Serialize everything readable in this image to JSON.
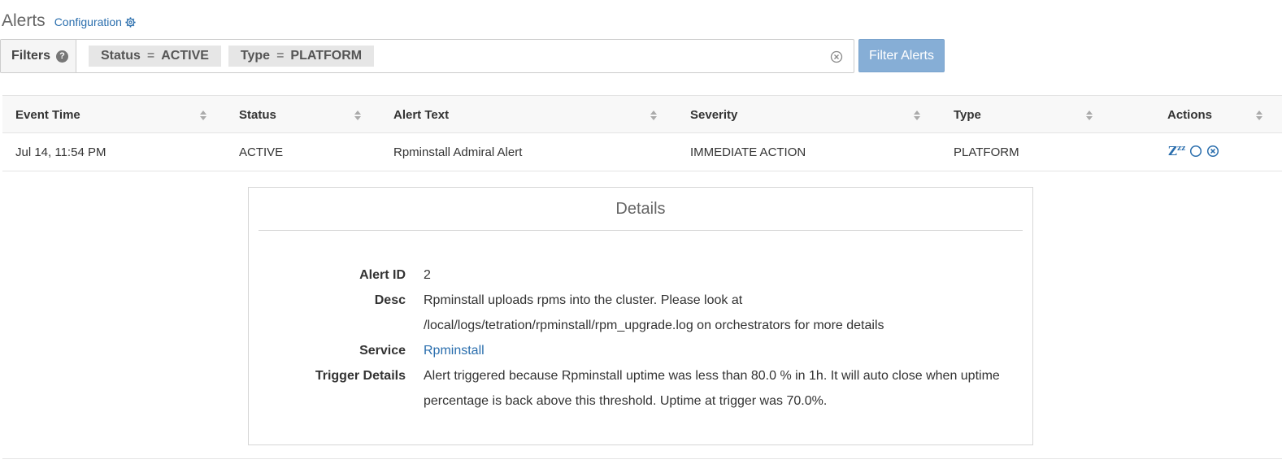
{
  "header": {
    "title": "Alerts",
    "config_label": "Configuration"
  },
  "filters": {
    "label": "Filters",
    "chips": [
      {
        "key": "Status",
        "op": "=",
        "value": "ACTIVE"
      },
      {
        "key": "Type",
        "op": "=",
        "value": "PLATFORM"
      }
    ],
    "button_label": "Filter Alerts"
  },
  "table": {
    "columns": [
      "Event Time",
      "Status",
      "Alert Text",
      "Severity",
      "Type",
      "Actions"
    ],
    "rows": [
      {
        "event_time": "Jul 14, 11:54 PM",
        "status": "ACTIVE",
        "alert_text": "Rpminstall Admiral Alert",
        "severity": "IMMEDIATE ACTION",
        "type": "PLATFORM",
        "snooze_symbol": "Z",
        "snooze_sup": "zz"
      }
    ]
  },
  "details": {
    "title": "Details",
    "alert_id_label": "Alert ID",
    "alert_id": "2",
    "desc_label": "Desc",
    "desc": "Rpminstall uploads rpms into the cluster. Please look at /local/logs/tetration/rpminstall/rpm_upgrade.log on orchestrators for more details",
    "service_label": "Service",
    "service": "Rpminstall",
    "trigger_label": "Trigger Details",
    "trigger": "Alert triggered because Rpminstall uptime was less than 80.0 % in 1h. It will auto close when uptime percentage is back above this threshold. Uptime at trigger was 70.0%."
  },
  "icons": {
    "config": "gear-icon",
    "help": "question-circle-icon",
    "clear": "clear-circle-icon",
    "sort": "sort-icon",
    "snooze": "snooze-icon",
    "acknowledge": "circle-icon",
    "close": "close-circle-icon"
  },
  "colors": {
    "link": "#2a6ead",
    "button": "#86aed6",
    "header_bg": "#f8f8f8"
  }
}
